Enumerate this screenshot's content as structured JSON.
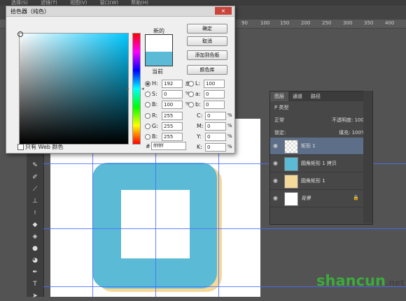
{
  "menubar": {
    "items": [
      "选择(S)",
      "滤镜(T)",
      "视图(V)",
      "窗口(W)",
      "帮助(H)"
    ]
  },
  "ruler": {
    "ticks": [
      "90",
      "100",
      "150",
      "200",
      "250",
      "300",
      "350",
      "400"
    ]
  },
  "dialog": {
    "title": "拾色器（纯色）",
    "close_icon": "×",
    "new_label": "新的",
    "current_label": "当前",
    "colors": {
      "new": "#ffffff",
      "current": "#5bbad5",
      "sv_hue": "#00c8ff"
    },
    "buttons": {
      "ok": "确定",
      "cancel": "取消",
      "add_to_swatches": "添加到色板",
      "color_libraries": "颜色库"
    },
    "hsb": {
      "h": {
        "label": "H:",
        "value": "192",
        "unit": "度"
      },
      "s": {
        "label": "S:",
        "value": "0",
        "unit": "%"
      },
      "b": {
        "label": "B:",
        "value": "100",
        "unit": "%"
      }
    },
    "rgb": {
      "r": {
        "label": "R:",
        "value": "255"
      },
      "g": {
        "label": "G:",
        "value": "255"
      },
      "b": {
        "label": "B:",
        "value": "255"
      }
    },
    "lab": {
      "l": {
        "label": "L:",
        "value": "100"
      },
      "a": {
        "label": "a:",
        "value": "0"
      },
      "b": {
        "label": "b:",
        "value": "0"
      }
    },
    "cmyk": {
      "c": {
        "label": "C:",
        "value": "0",
        "unit": "%"
      },
      "m": {
        "label": "M:",
        "value": "0",
        "unit": "%"
      },
      "y": {
        "label": "Y:",
        "value": "0",
        "unit": "%"
      },
      "k": {
        "label": "K:",
        "value": "0",
        "unit": "%"
      }
    },
    "web_only_label": "只有 Web 颜色",
    "hex_label": "#",
    "hex_value": "ffffff"
  },
  "layers_panel": {
    "tabs": [
      "图层",
      "通道",
      "路径"
    ],
    "filter_label": "P 类型",
    "blend_mode": "正常",
    "opacity_label": "不透明度:",
    "opacity_value": "100%",
    "lock_label": "锁定:",
    "fill_label": "填充:",
    "fill_value": "100%",
    "layers": [
      {
        "name": "矩形 1"
      },
      {
        "name": "圆角矩形 1 拷贝"
      },
      {
        "name": "圆角矩形 1"
      },
      {
        "name": "背景"
      }
    ]
  },
  "canvas_colors": {
    "rounded_square": "#5bbad5",
    "shadow": "#f4d99a",
    "inner": "#ffffff"
  },
  "watermark": {
    "text": "shancun",
    "suffix": ".net"
  }
}
